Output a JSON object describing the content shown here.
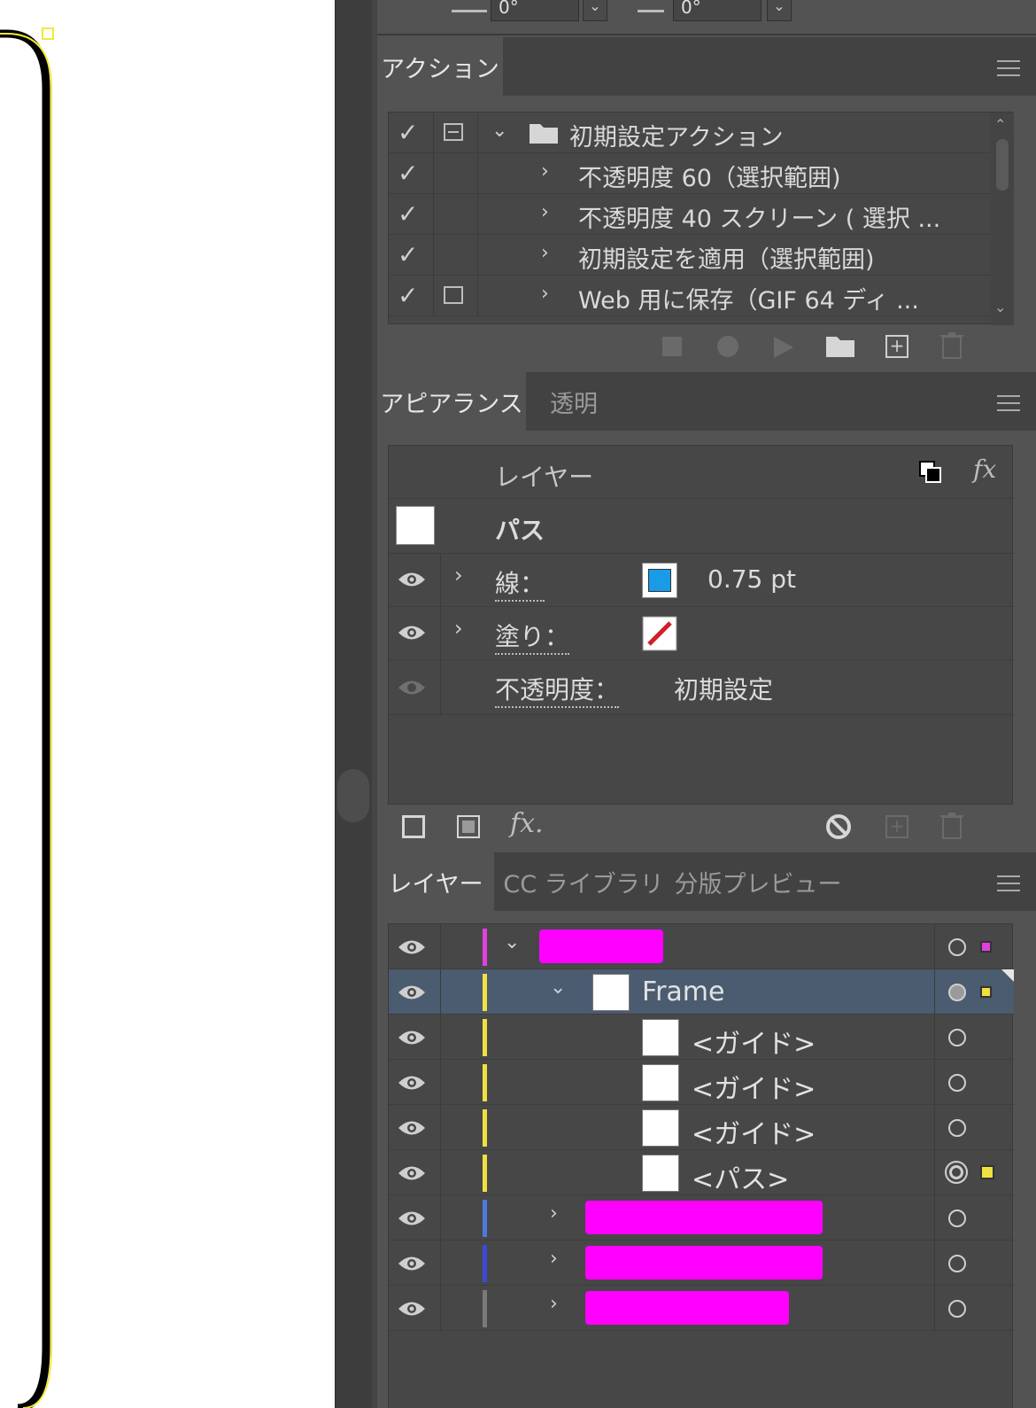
{
  "top_strip": {
    "field1_value": "0°",
    "field2_value": "0°"
  },
  "actions_panel": {
    "tabs": [
      {
        "label": "アクション"
      }
    ],
    "rows": [
      {
        "label": "初期設定アクション",
        "type": "set",
        "expanded": true,
        "checked": true,
        "dialog_toggle": true
      },
      {
        "label": "不透明度 60（選択範囲)",
        "type": "action",
        "checked": true,
        "dialog_toggle": false
      },
      {
        "label": "不透明度 40 スクリーン ( 選択 ...",
        "type": "action",
        "checked": true,
        "dialog_toggle": false
      },
      {
        "label": "初期設定を適用（選択範囲)",
        "type": "action",
        "checked": true,
        "dialog_toggle": false
      },
      {
        "label": "Web 用に保存（GIF 64 ディ ...",
        "type": "action",
        "checked": true,
        "dialog_toggle": true
      }
    ],
    "footer_icons": [
      "stop-icon",
      "record-icon",
      "play-icon",
      "new-set-folder-icon",
      "new-action-icon",
      "delete-icon"
    ]
  },
  "appearance_panel": {
    "tabs": [
      {
        "label": "アピアランス",
        "active": true
      },
      {
        "label": "透明",
        "active": false
      }
    ],
    "header_label": "レイヤー",
    "object_label": "パス",
    "stroke": {
      "label": "線：",
      "weight": "0.75 pt",
      "color": "#1a9be8"
    },
    "fill": {
      "label": "塗り：",
      "color": "none"
    },
    "opacity": {
      "label": "不透明度：",
      "value": "初期設定"
    },
    "footer_icons": [
      "add-stroke-icon",
      "add-fill-icon",
      "fx-icon",
      "clear-appearance-icon",
      "duplicate-item-icon",
      "delete-item-icon"
    ]
  },
  "layers_panel": {
    "tabs": [
      {
        "label": "レイヤー",
        "active": true
      },
      {
        "label": "CC ライブラリ",
        "active": false
      },
      {
        "label": "分版プレビュー",
        "active": false
      }
    ],
    "rows": [
      {
        "name": "",
        "redacted": true,
        "color": "#e040e0",
        "level": 0,
        "twisty": "down",
        "selected": false
      },
      {
        "name": "Frame",
        "color": "#f0e040",
        "level": 1,
        "twisty": "down",
        "selected": true
      },
      {
        "name": "<ガイド>",
        "color": "#f0e040",
        "level": 2,
        "twisty": "",
        "selected": false
      },
      {
        "name": "<ガイド>",
        "color": "#f0e040",
        "level": 2,
        "twisty": "",
        "selected": false
      },
      {
        "name": "<ガイド>",
        "color": "#f0e040",
        "level": 2,
        "twisty": "",
        "selected": false
      },
      {
        "name": "<パス>",
        "color": "#f0e040",
        "level": 2,
        "twisty": "",
        "selected": false
      },
      {
        "name": "",
        "redacted": true,
        "color": "#4a7ae0",
        "level": 1,
        "twisty": "right",
        "selected": false
      },
      {
        "name": "",
        "redacted": true,
        "color": "#3a4ad8",
        "level": 1,
        "twisty": "right",
        "selected": false
      },
      {
        "name": "",
        "redacted": true,
        "color": "#7a7a7a",
        "level": 1,
        "twisty": "right",
        "selected": false
      }
    ]
  }
}
